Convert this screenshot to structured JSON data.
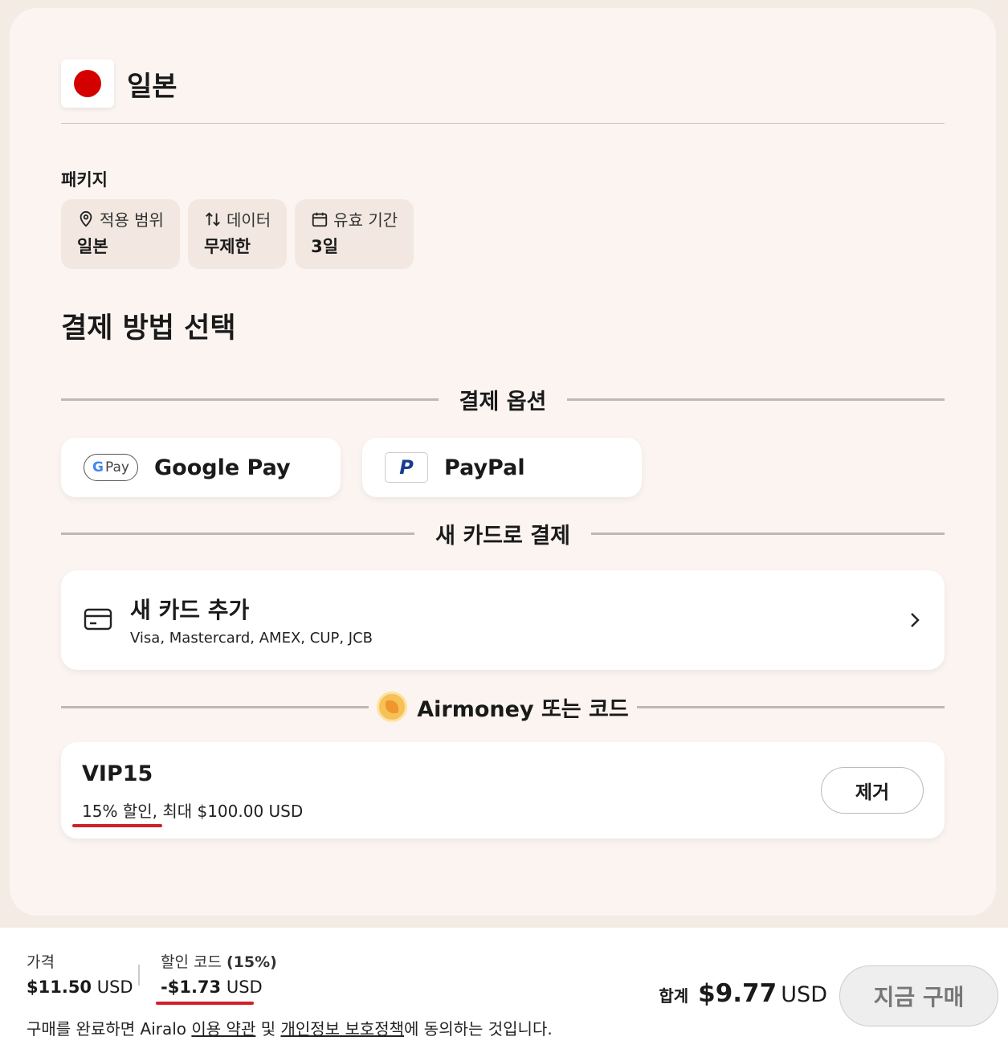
{
  "country": {
    "name": "일본",
    "flag_color": "#d40000"
  },
  "package": {
    "label": "패키지",
    "chips": [
      {
        "title": "적용 범위",
        "value": "일본",
        "icon": "location-pin-icon"
      },
      {
        "title": "데이터",
        "value": "무제한",
        "icon": "data-arrows-icon"
      },
      {
        "title": "유효 기간",
        "value": "3일",
        "icon": "calendar-icon"
      }
    ]
  },
  "payment": {
    "title": "결제 방법 선택",
    "options_label": "결제 옵션",
    "gpay_pill": "Pay",
    "gpay_g": "G",
    "google_pay": "Google Pay",
    "paypal_logo": "P",
    "paypal": "PayPal",
    "new_card_label": "새 카드로 결제",
    "new_card_title": "새 카드 추가",
    "new_card_brands": "Visa, Mastercard, AMEX, CUP, JCB",
    "airmoney_label": "Airmoney 또는 코드"
  },
  "promo": {
    "code": "VIP15",
    "description": "15% 할인, 최대 $100.00 USD",
    "remove_label": "제거"
  },
  "footer": {
    "price_label": "가격",
    "price_amount": "$11.50",
    "price_currency": "USD",
    "discount_label_prefix": "할인 코드 ",
    "discount_label_pct": "(15%)",
    "discount_amount": "-$1.73",
    "discount_currency": "USD",
    "total_label": "합계",
    "total_amount": "$9.77",
    "total_currency": "USD",
    "buy_label": "지금 구매",
    "terms_prefix": "구매를 완료하면 Airalo ",
    "terms_link": "이용 약관",
    "terms_mid": " 및 ",
    "privacy_link": "개인정보 보호정책",
    "terms_suffix": "에 동의하는 것입니다."
  },
  "colors": {
    "accent_red": "#d0202a",
    "card_bg": "#fbf4f0",
    "page_bg": "#f3ebe4"
  }
}
